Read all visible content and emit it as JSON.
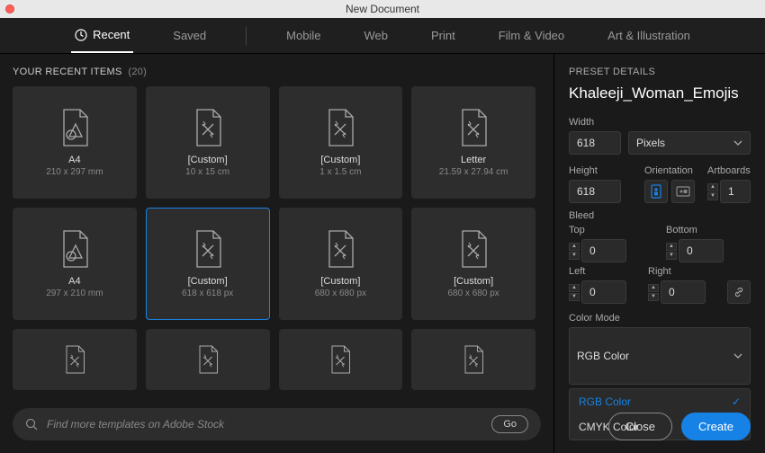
{
  "window": {
    "title": "New Document"
  },
  "tabs": [
    {
      "label": "Recent",
      "active": true
    },
    {
      "label": "Saved"
    },
    {
      "label": "Mobile"
    },
    {
      "label": "Web"
    },
    {
      "label": "Print"
    },
    {
      "label": "Film & Video"
    },
    {
      "label": "Art & Illustration"
    }
  ],
  "section": {
    "title": "YOUR RECENT ITEMS",
    "count": "(20)"
  },
  "presets": [
    {
      "label": "A4",
      "dim": "210 x 297 mm",
      "icon": "a4"
    },
    {
      "label": "[Custom]",
      "dim": "10 x 15 cm",
      "icon": "custom"
    },
    {
      "label": "[Custom]",
      "dim": "1 x 1.5 cm",
      "icon": "custom"
    },
    {
      "label": "Letter",
      "dim": "21.59 x 27.94 cm",
      "icon": "custom"
    },
    {
      "label": "A4",
      "dim": "297 x 210 mm",
      "icon": "a4"
    },
    {
      "label": "[Custom]",
      "dim": "618 x 618 px",
      "icon": "custom",
      "selected": true
    },
    {
      "label": "[Custom]",
      "dim": "680 x 680 px",
      "icon": "custom"
    },
    {
      "label": "[Custom]",
      "dim": "680 x 680 px",
      "icon": "custom"
    },
    {
      "label": "",
      "dim": "",
      "icon": "custom"
    },
    {
      "label": "",
      "dim": "",
      "icon": "custom"
    },
    {
      "label": "",
      "dim": "",
      "icon": "custom"
    },
    {
      "label": "",
      "dim": "",
      "icon": "custom"
    }
  ],
  "search": {
    "placeholder": "Find more templates on Adobe Stock",
    "go": "Go"
  },
  "details": {
    "heading": "PRESET DETAILS",
    "name": "Khaleeji_Woman_Emojis",
    "width_label": "Width",
    "width": "618",
    "units": "Pixels",
    "height_label": "Height",
    "height": "618",
    "orientation_label": "Orientation",
    "artboards_label": "Artboards",
    "artboards": "1",
    "bleed_label": "Bleed",
    "top_label": "Top",
    "top": "0",
    "bottom_label": "Bottom",
    "bottom": "0",
    "left_label": "Left",
    "left": "0",
    "right_label": "Right",
    "right": "0",
    "color_mode_label": "Color Mode",
    "color_mode": "RGB Color",
    "color_options": [
      "RGB Color",
      "CMYK Color"
    ]
  },
  "buttons": {
    "close": "Close",
    "create": "Create"
  }
}
